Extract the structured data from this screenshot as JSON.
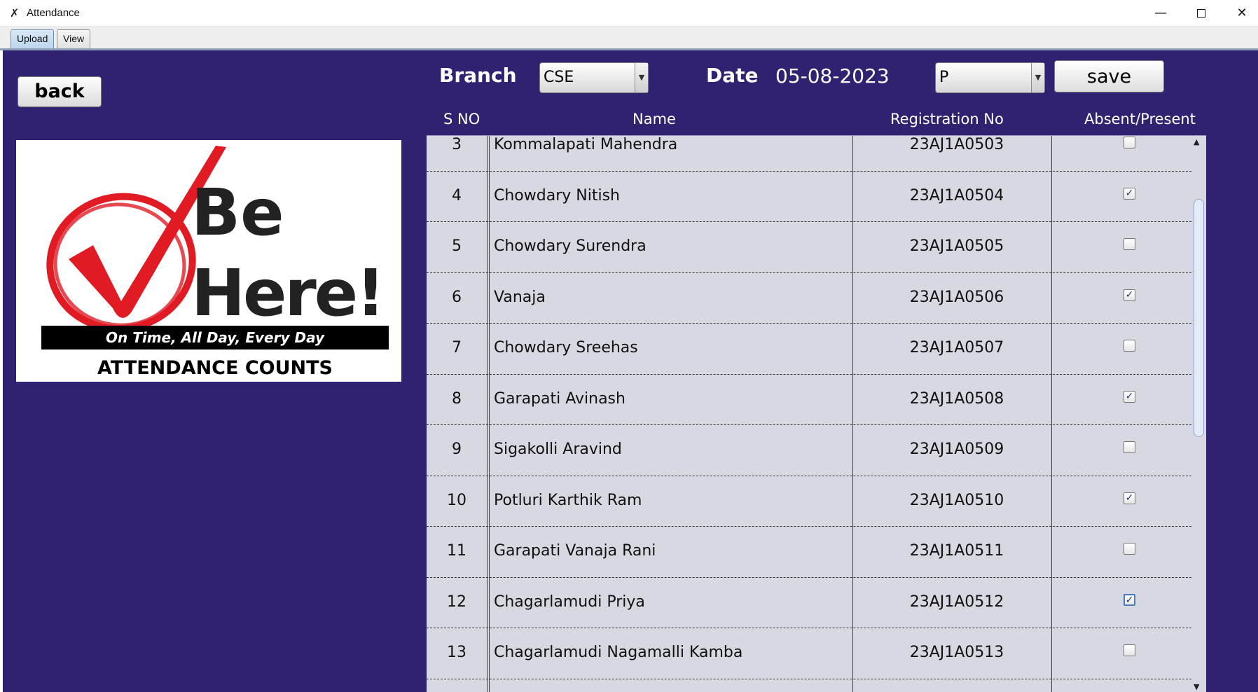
{
  "window": {
    "title": "Attendance",
    "app_icon": "✗",
    "minimize": "—",
    "close": "✕"
  },
  "tabs": [
    {
      "label": "Upload",
      "selected": true
    },
    {
      "label": "View",
      "selected": false
    }
  ],
  "toolbar": {
    "back_label": "back",
    "branch_label": "Branch",
    "branch_value": "CSE",
    "date_label": "Date",
    "date_value": "05-08-2023",
    "status_value": "P",
    "save_label": "save",
    "dropdown_arrow": "▼"
  },
  "logo": {
    "line1": "Be",
    "line2": "Here!",
    "tagline": "On Time, All Day, Every Day",
    "caption": "ATTENDANCE COUNTS"
  },
  "table": {
    "headers": {
      "sno": "S NO",
      "name": "Name",
      "reg": "Registration No",
      "status": "Absent/Present"
    },
    "rows": [
      {
        "sno": "3",
        "name": "Kommalapati Mahendra",
        "reg": "23AJ1A0503",
        "present": false
      },
      {
        "sno": "4",
        "name": "Chowdary Nitish",
        "reg": "23AJ1A0504",
        "present": true
      },
      {
        "sno": "5",
        "name": "Chowdary Surendra",
        "reg": "23AJ1A0505",
        "present": false
      },
      {
        "sno": "6",
        "name": "Vanaja",
        "reg": "23AJ1A0506",
        "present": true
      },
      {
        "sno": "7",
        "name": "Chowdary Sreehas",
        "reg": "23AJ1A0507",
        "present": false
      },
      {
        "sno": "8",
        "name": "Garapati  Avinash",
        "reg": "23AJ1A0508",
        "present": true
      },
      {
        "sno": "9",
        "name": "Sigakolli Aravind",
        "reg": "23AJ1A0509",
        "present": false
      },
      {
        "sno": "10",
        "name": "Potluri Karthik Ram",
        "reg": "23AJ1A0510",
        "present": true
      },
      {
        "sno": "11",
        "name": "Garapati Vanaja Rani",
        "reg": "23AJ1A0511",
        "present": false
      },
      {
        "sno": "12",
        "name": "Chagarlamudi Priya",
        "reg": "23AJ1A0512",
        "present": true
      },
      {
        "sno": "13",
        "name": "Chagarlamudi Nagamalli Kamba",
        "reg": "23AJ1A0513",
        "present": false
      }
    ],
    "checkmark": "✓",
    "scroll_up": "▲",
    "scroll_down": "▼"
  }
}
